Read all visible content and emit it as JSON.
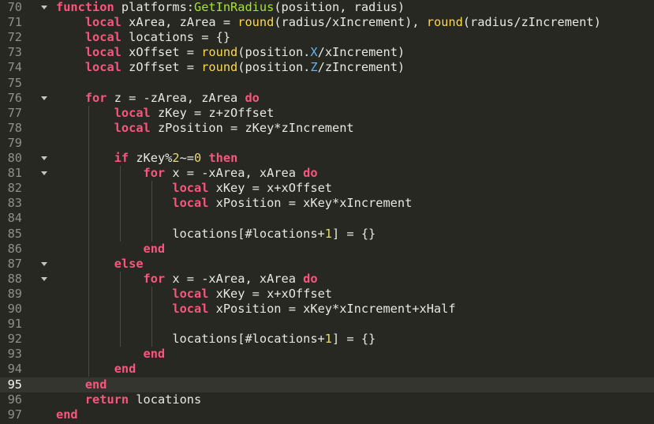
{
  "editor": {
    "active_line": 95,
    "lines": [
      {
        "num": "70",
        "fold": true,
        "tokens": [
          [
            "kw",
            "function"
          ],
          [
            "id",
            " platforms:"
          ],
          [
            "fn",
            "GetInRadius"
          ],
          [
            "id",
            "(position, radius)"
          ]
        ]
      },
      {
        "num": "71",
        "fold": false,
        "tokens": [
          [
            "id",
            "    "
          ],
          [
            "kw",
            "local"
          ],
          [
            "id",
            " xArea, zArea = "
          ],
          [
            "call",
            "round"
          ],
          [
            "id",
            "(radius/xIncrement), "
          ],
          [
            "call",
            "round"
          ],
          [
            "id",
            "(radius/zIncrement)"
          ]
        ]
      },
      {
        "num": "72",
        "fold": false,
        "tokens": [
          [
            "id",
            "    "
          ],
          [
            "kw",
            "local"
          ],
          [
            "id",
            " locations = {}"
          ]
        ]
      },
      {
        "num": "73",
        "fold": false,
        "tokens": [
          [
            "id",
            "    "
          ],
          [
            "kw",
            "local"
          ],
          [
            "id",
            " xOffset = "
          ],
          [
            "call",
            "round"
          ],
          [
            "id",
            "(position."
          ],
          [
            "prop",
            "X"
          ],
          [
            "id",
            "/xIncrement)"
          ]
        ]
      },
      {
        "num": "74",
        "fold": false,
        "tokens": [
          [
            "id",
            "    "
          ],
          [
            "kw",
            "local"
          ],
          [
            "id",
            " zOffset = "
          ],
          [
            "call",
            "round"
          ],
          [
            "id",
            "(position."
          ],
          [
            "prop",
            "Z"
          ],
          [
            "id",
            "/zIncrement)"
          ]
        ]
      },
      {
        "num": "75",
        "fold": false,
        "tokens": []
      },
      {
        "num": "76",
        "fold": true,
        "tokens": [
          [
            "id",
            "    "
          ],
          [
            "kw",
            "for"
          ],
          [
            "id",
            " z = -zArea, zArea "
          ],
          [
            "kw",
            "do"
          ]
        ]
      },
      {
        "num": "77",
        "fold": false,
        "tokens": [
          [
            "id",
            "        "
          ],
          [
            "kw",
            "local"
          ],
          [
            "id",
            " zKey = z+zOffset"
          ]
        ]
      },
      {
        "num": "78",
        "fold": false,
        "tokens": [
          [
            "id",
            "        "
          ],
          [
            "kw",
            "local"
          ],
          [
            "id",
            " zPosition = zKey*zIncrement"
          ]
        ]
      },
      {
        "num": "79",
        "fold": false,
        "tokens": []
      },
      {
        "num": "80",
        "fold": true,
        "tokens": [
          [
            "id",
            "        "
          ],
          [
            "kw",
            "if"
          ],
          [
            "id",
            " zKey%"
          ],
          [
            "num",
            "2"
          ],
          [
            "id",
            "~="
          ],
          [
            "num",
            "0"
          ],
          [
            "id",
            " "
          ],
          [
            "kw",
            "then"
          ]
        ]
      },
      {
        "num": "81",
        "fold": true,
        "tokens": [
          [
            "id",
            "            "
          ],
          [
            "kw",
            "for"
          ],
          [
            "id",
            " x = -xArea, xArea "
          ],
          [
            "kw",
            "do"
          ]
        ]
      },
      {
        "num": "82",
        "fold": false,
        "tokens": [
          [
            "id",
            "                "
          ],
          [
            "kw",
            "local"
          ],
          [
            "id",
            " xKey = x+xOffset"
          ]
        ]
      },
      {
        "num": "83",
        "fold": false,
        "tokens": [
          [
            "id",
            "                "
          ],
          [
            "kw",
            "local"
          ],
          [
            "id",
            " xPosition = xKey*xIncrement"
          ]
        ]
      },
      {
        "num": "84",
        "fold": false,
        "tokens": []
      },
      {
        "num": "85",
        "fold": false,
        "tokens": [
          [
            "id",
            "                locations[#locations+"
          ],
          [
            "num",
            "1"
          ],
          [
            "id",
            "] = {}"
          ]
        ]
      },
      {
        "num": "86",
        "fold": false,
        "tokens": [
          [
            "id",
            "            "
          ],
          [
            "kw",
            "end"
          ]
        ]
      },
      {
        "num": "87",
        "fold": true,
        "tokens": [
          [
            "id",
            "        "
          ],
          [
            "kw",
            "else"
          ]
        ]
      },
      {
        "num": "88",
        "fold": true,
        "tokens": [
          [
            "id",
            "            "
          ],
          [
            "kw",
            "for"
          ],
          [
            "id",
            " x = -xArea, xArea "
          ],
          [
            "kw",
            "do"
          ]
        ]
      },
      {
        "num": "89",
        "fold": false,
        "tokens": [
          [
            "id",
            "                "
          ],
          [
            "kw",
            "local"
          ],
          [
            "id",
            " xKey = x+xOffset"
          ]
        ]
      },
      {
        "num": "90",
        "fold": false,
        "tokens": [
          [
            "id",
            "                "
          ],
          [
            "kw",
            "local"
          ],
          [
            "id",
            " xPosition = xKey*xIncrement+xHalf"
          ]
        ]
      },
      {
        "num": "91",
        "fold": false,
        "tokens": []
      },
      {
        "num": "92",
        "fold": false,
        "tokens": [
          [
            "id",
            "                locations[#locations+"
          ],
          [
            "num",
            "1"
          ],
          [
            "id",
            "] = {}"
          ]
        ]
      },
      {
        "num": "93",
        "fold": false,
        "tokens": [
          [
            "id",
            "            "
          ],
          [
            "kw",
            "end"
          ]
        ]
      },
      {
        "num": "94",
        "fold": false,
        "tokens": [
          [
            "id",
            "        "
          ],
          [
            "kw",
            "end"
          ]
        ]
      },
      {
        "num": "95",
        "fold": false,
        "tokens": [
          [
            "id",
            "    "
          ],
          [
            "kw",
            "end"
          ]
        ]
      },
      {
        "num": "96",
        "fold": false,
        "tokens": [
          [
            "id",
            "    "
          ],
          [
            "kw",
            "return"
          ],
          [
            "id",
            " locations"
          ]
        ]
      },
      {
        "num": "97",
        "fold": false,
        "tokens": [
          [
            "kw",
            "end"
          ]
        ]
      }
    ]
  }
}
